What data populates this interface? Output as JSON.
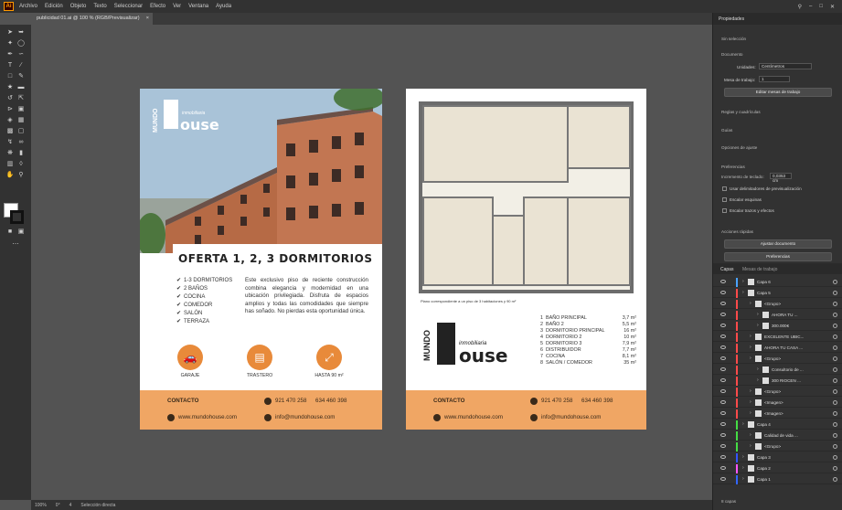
{
  "menu": {
    "app_badge": "Ai",
    "items": [
      "Archivo",
      "Edición",
      "Objeto",
      "Texto",
      "Seleccionar",
      "Efecto",
      "Ver",
      "Ventana",
      "Ayuda"
    ]
  },
  "document_tab": {
    "title": "publicidad 01.ai @ 100 % (RGB/Previsualizar)",
    "close_glyph": "×"
  },
  "status": {
    "zoom": "100%",
    "angle": "0°",
    "artboard": "4",
    "tool": "Selección directa"
  },
  "properties_panel": {
    "tabs": [
      "Propiedades",
      "Bibliotecas"
    ],
    "no_selection": "Sin selección",
    "document_section": "Documento",
    "units_label": "Unidades:",
    "units_value": "Centímetros",
    "artboard_label": "Mesa de trabajo:",
    "artboard_value": "1",
    "edit_artboards_button": "Editar mesas de trabajo",
    "rulers_grids_label": "Reglas y cuadrículas",
    "guides_label": "Guías",
    "snap_label": "Opciones de ajuste",
    "preferences_section": "Preferencias",
    "keyboard_increment_label": "Incremento de teclado:",
    "keyboard_increment_value": "0,0353 cm",
    "check_preview_bounds": "Usar delimitadores de previsualización",
    "check_scale_corners": "Escalar esquinas",
    "check_scale_strokes": "Escalar trazos y efectos",
    "quick_actions_section": "Acciones rápidas",
    "fit_document_button": "Ajustar documento",
    "preferences_button": "Preferencias"
  },
  "layers_panel": {
    "tabs": [
      "Capas",
      "Mesas de trabajo"
    ],
    "rows": [
      {
        "name": "Capa 6",
        "indent": 0,
        "color": "#4aa3ff"
      },
      {
        "name": "Capa 5",
        "indent": 0,
        "color": "#ff4a4a"
      },
      {
        "name": "<Grupo>",
        "indent": 1,
        "color": "#ff4a4a"
      },
      {
        "name": "AHORA TU ...",
        "indent": 2,
        "color": "#ff4a4a"
      },
      {
        "name": "300.000€",
        "indent": 2,
        "color": "#ff4a4a"
      },
      {
        "name": "EXCELENTE UBIC...",
        "indent": 1,
        "color": "#ff4a4a"
      },
      {
        "name": "AHORA TU CASA ...",
        "indent": 1,
        "color": "#ff4a4a"
      },
      {
        "name": "<Grupo>",
        "indent": 1,
        "color": "#ff4a4a"
      },
      {
        "name": "Consultorio de ...",
        "indent": 2,
        "color": "#ff4a4a"
      },
      {
        "name": "300 RIOCEN ...",
        "indent": 2,
        "color": "#ff4a4a"
      },
      {
        "name": "<Grupo>",
        "indent": 1,
        "color": "#ff4a4a"
      },
      {
        "name": "<Imagen>",
        "indent": 1,
        "color": "#ff4a4a"
      },
      {
        "name": "<Imagen>",
        "indent": 1,
        "color": "#ff4a4a"
      },
      {
        "name": "Capa 4",
        "indent": 0,
        "color": "#44dd44"
      },
      {
        "name": "Calidad de vida ...",
        "indent": 1,
        "color": "#44dd44"
      },
      {
        "name": "<Grupo>",
        "indent": 1,
        "color": "#44dd44"
      },
      {
        "name": "Capa 3",
        "indent": 0,
        "color": "#3355ff"
      },
      {
        "name": "Capa 2",
        "indent": 0,
        "color": "#ff55ff"
      },
      {
        "name": "Capa 1",
        "indent": 0,
        "color": "#3366ff"
      }
    ],
    "footer_label": "8 capas"
  },
  "flyer_front": {
    "brand_top": "MUNDO",
    "brand_sub": "inmobiliaria",
    "brand_main": "ouse",
    "offer_title": "OFERTA 1, 2, 3 DORMITORIOS",
    "features": [
      "1-3 DORMITORIOS",
      "2 BAÑOS",
      "COCINA",
      "COMEDOR",
      "SALÓN",
      "TERRAZA"
    ],
    "check_glyph": "✔",
    "description": "Este exclusivo piso de reciente construcción combina elegancia y modernidad en una ubicación privilegiada. Disfruta de espacios amplios y todas las comodidades que siempre has soñado. No pierdas esta oportunidad única.",
    "badges": [
      {
        "icon": "car-icon",
        "glyph": "🚗",
        "label": "GARAJE"
      },
      {
        "icon": "storage-icon",
        "glyph": "▤",
        "label": "TRASTERO"
      },
      {
        "icon": "area-icon",
        "glyph": "⤢",
        "label": "HASTA 90 m²"
      }
    ]
  },
  "flyer_back": {
    "plan_note": "Plano correspondiente a un piso de 3 habitaciones y 90 m²",
    "brand_top": "MUNDO",
    "brand_sub": "inmobiliaria",
    "brand_main": "ouse",
    "rooms": [
      {
        "num": "1",
        "name": "BAÑO PRINCIPAL",
        "area": "3,7 m²"
      },
      {
        "num": "2",
        "name": "BAÑO 2",
        "area": "5,5 m²"
      },
      {
        "num": "3",
        "name": "DORMITORIO PRINCIPAL",
        "area": "16 m²"
      },
      {
        "num": "4",
        "name": "DORMITORIO 2",
        "area": "10 m²"
      },
      {
        "num": "5",
        "name": "DORMITORIO 3",
        "area": "7,9 m²"
      },
      {
        "num": "6",
        "name": "DISTRIBUIDOR",
        "area": "7,7 m²"
      },
      {
        "num": "7",
        "name": "COCINA",
        "area": "8,1 m²"
      },
      {
        "num": "8",
        "name": "SALÓN / COMEDOR",
        "area": "35 m²"
      }
    ]
  },
  "contact": {
    "title": "CONTACTO",
    "phone1": "921 470 258",
    "phone2": "634 460 398",
    "web": "www.mundohouse.com",
    "email": "info@mundohouse.com"
  },
  "colors": {
    "accent_orange": "#e88a3a",
    "contact_band": "#f0a664",
    "ui_dark": "#323232",
    "canvas": "#535353"
  }
}
